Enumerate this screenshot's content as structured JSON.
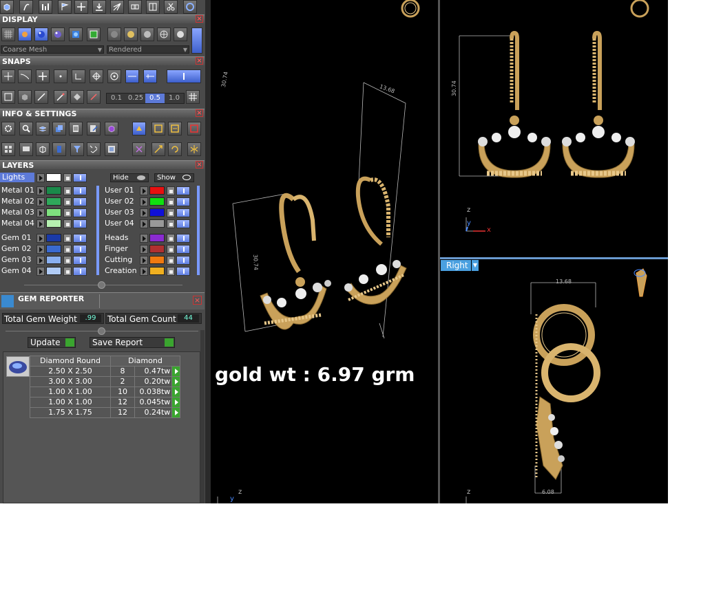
{
  "display": {
    "title": "DISPLAY",
    "mesh_dropdown": "Coarse Mesh",
    "render_dropdown": "Rendered"
  },
  "snaps": {
    "title": "SNAPS",
    "steps": [
      "0.1",
      "0.25",
      "0.5",
      "1.0"
    ],
    "active_step": "0.5"
  },
  "info_settings": {
    "title": "INFO & SETTINGS"
  },
  "layers": {
    "title": "LAYERS",
    "lights_label": "Lights",
    "hide_label": "Hide",
    "show_label": "Show",
    "left": [
      {
        "name": "Metal 01",
        "color": "#1a8a4a"
      },
      {
        "name": "Metal 02",
        "color": "#2fa85a"
      },
      {
        "name": "Metal 03",
        "color": "#7ee07e"
      },
      {
        "name": "Metal 04",
        "color": "#b6f0b0"
      },
      {
        "name": "Gem 01",
        "color": "#1a3aa8"
      },
      {
        "name": "Gem 02",
        "color": "#3a6ad0"
      },
      {
        "name": "Gem 03",
        "color": "#8ab0f0"
      },
      {
        "name": "Gem 04",
        "color": "#b0cbf5"
      }
    ],
    "right": [
      {
        "name": "User 01",
        "color": "#e81010"
      },
      {
        "name": "User 02",
        "color": "#10e010"
      },
      {
        "name": "User 03",
        "color": "#1010d8"
      },
      {
        "name": "User 04",
        "color": "#999999"
      },
      {
        "name": "Heads",
        "color": "#8a2bd0"
      },
      {
        "name": "Finger",
        "color": "#b03030"
      },
      {
        "name": "Cutting",
        "color": "#f07a10"
      },
      {
        "name": "Creation",
        "color": "#f0b020"
      }
    ]
  },
  "gem_reporter": {
    "title": "GEM REPORTER",
    "total_weight_label": "Total Gem Weight",
    "total_weight_value": ".99",
    "total_count_label": "Total Gem Count",
    "total_count_value": "44",
    "update_label": "Update",
    "save_label": "Save Report",
    "table_header": [
      "Diamond Round",
      "Diamond"
    ],
    "rows": [
      {
        "size": "2.50 X 2.50",
        "count": "8",
        "weight": "0.47tw"
      },
      {
        "size": "3.00 X 3.00",
        "count": "2",
        "weight": "0.20tw"
      },
      {
        "size": "1.00 X 1.00",
        "count": "10",
        "weight": "0.038tw"
      },
      {
        "size": "1.00 X 1.00",
        "count": "12",
        "weight": "0.045tw"
      },
      {
        "size": "1.75 X 1.75",
        "count": "12",
        "weight": "0.24tw"
      }
    ]
  },
  "viewports": {
    "gold_weight": "gold wt : 6.97 grm",
    "persp_dim_height": "30.74",
    "persp_dim_width": "13.68",
    "front_dim_height": "30.74",
    "right_view_label": "Right",
    "right_dim_top": "13.68",
    "right_dim_bottom": "6.08",
    "axis_z": "z",
    "axis_y": "y",
    "axis_x": "x"
  }
}
